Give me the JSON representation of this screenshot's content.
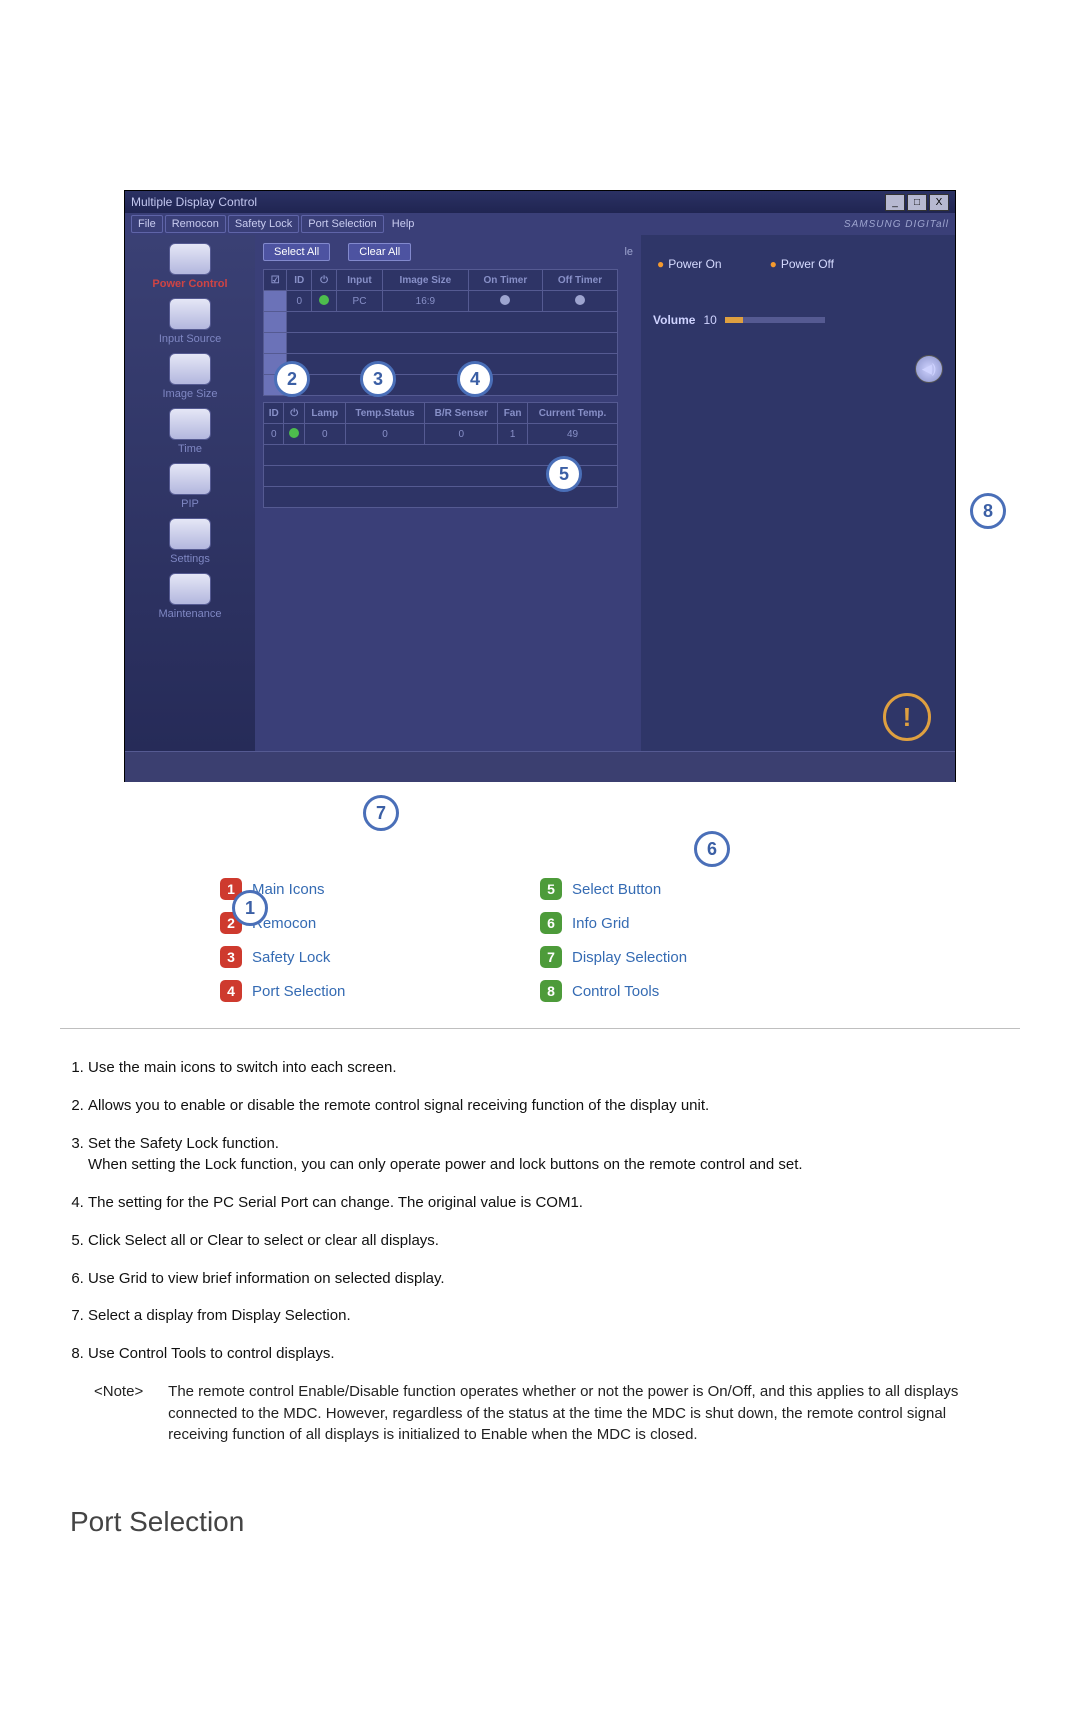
{
  "app": {
    "title": "Multiple Display Control",
    "brand": "SAMSUNG DIGITall"
  },
  "menu": {
    "file": "File",
    "remocon": "Remocon",
    "safety": "Safety Lock",
    "port": "Port Selection",
    "help": "Help"
  },
  "sidebar": {
    "items": [
      {
        "label": "Power Control",
        "name": "power-control"
      },
      {
        "label": "Input Source",
        "name": "input-source"
      },
      {
        "label": "Image Size",
        "name": "image-size"
      },
      {
        "label": "Time",
        "name": "time"
      },
      {
        "label": "PIP",
        "name": "pip"
      },
      {
        "label": "Settings",
        "name": "settings"
      },
      {
        "label": "Maintenance",
        "name": "maintenance"
      }
    ]
  },
  "buttons": {
    "select_all": "Select All",
    "clear_all": "Clear All",
    "scroll_label": "le"
  },
  "table_main": {
    "headers": [
      "☑",
      "ID",
      "⏻",
      "Input",
      "Image Size",
      "On Timer",
      "Off Timer"
    ],
    "row": {
      "id": "0",
      "input": "PC",
      "size": "16:9"
    }
  },
  "table_sub": {
    "headers": [
      "ID",
      "⏻",
      "Lamp",
      "Temp.Status",
      "B/R Senser",
      "Fan",
      "Current Temp."
    ],
    "row": {
      "id": "0",
      "lamp": "0",
      "temp": "0",
      "br": "0",
      "fan": "1",
      "cur": "49"
    }
  },
  "right_panel": {
    "power_on": "Power On",
    "power_off": "Power Off",
    "volume_label": "Volume",
    "volume_value": "10"
  },
  "legend": {
    "i1": "Main Icons",
    "i2": "Remocon",
    "i3": "Safety Lock",
    "i4": "Port Selection",
    "i5": "Select Button",
    "i6": "Info Grid",
    "i7": "Display Selection",
    "i8": "Control Tools"
  },
  "notes": {
    "n1": "Use the main icons to switch into each screen.",
    "n2": "Allows you to enable or disable the remote control signal receiving function of the display unit.",
    "n3a": "Set the Safety Lock function.",
    "n3b": "When setting the Lock function, you can only operate power and lock buttons on the remote control and set.",
    "n4": "The setting for the PC Serial Port can change. The original value is COM1.",
    "n5": "Click Select all or Clear to select or clear all displays.",
    "n6": "Use Grid to view brief information on selected display.",
    "n7": "Select a display from Display Selection.",
    "n8": "Use Control Tools to control displays.",
    "note_label": "<Note>",
    "note_text": "The remote control Enable/Disable function operates whether or not the power is On/Off, and this applies to all displays connected to the MDC. However, regardless of the status at the time the MDC is shut down, the remote control signal receiving function of all displays is initialized to Enable when the MDC is closed."
  },
  "section": {
    "title": "Port Selection"
  }
}
